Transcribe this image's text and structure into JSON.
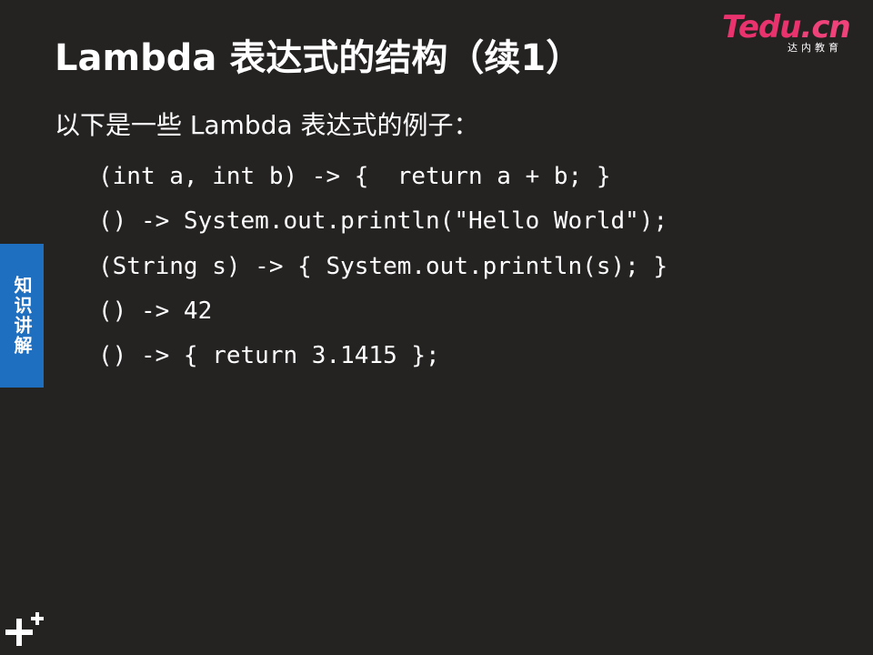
{
  "slide": {
    "title": "Lambda 表达式的结构（续1）",
    "subtitle": "以下是一些 Lambda 表达式的例子：",
    "code_lines": [
      "(int a, int b) -> {  return a + b; }",
      "() -> System.out.println(\"Hello World\");",
      "(String s) -> { System.out.println(s); }",
      "() -> 42",
      "() -> { return 3.1415 };"
    ]
  },
  "logo": {
    "main_t": "T",
    "main_rest": "edu",
    "main_cn": ".cn",
    "sub": "达内教育"
  },
  "side_tab": {
    "label": "知识讲解"
  },
  "colors": {
    "background": "#252222",
    "side_tab": "#1f6fc0",
    "logo": "#e8336e",
    "text": "#ffffff"
  },
  "icons": {
    "bottom_left": "plus-icon"
  }
}
